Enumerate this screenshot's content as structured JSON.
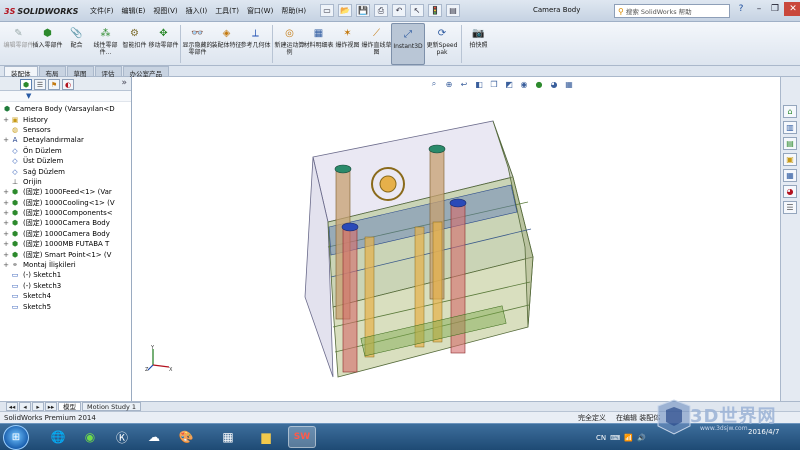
{
  "app": {
    "logo_prefix": "3S",
    "logo_text": "SOLIDWORKS",
    "document_title": "Camera Body"
  },
  "menu": [
    "文件(F)",
    "编辑(E)",
    "视图(V)",
    "插入(I)",
    "工具(T)",
    "窗口(W)",
    "帮助(H)"
  ],
  "help_search": {
    "placeholder": "搜索 SolidWorks 帮助"
  },
  "ribbon": {
    "buttons": [
      {
        "label": "编辑零部件",
        "icon": "edit-component-icon",
        "disabled": true
      },
      {
        "label": "插入零部件",
        "icon": "insert-component-icon"
      },
      {
        "label": "配合",
        "icon": "mate-icon"
      },
      {
        "label": "线性零部件...",
        "icon": "linear-pattern-icon"
      },
      {
        "label": "智能扣件",
        "icon": "smart-fastener-icon"
      },
      {
        "label": "移动零部件",
        "icon": "move-component-icon"
      },
      {
        "label": "显示隐藏的零部件",
        "icon": "show-hidden-icon"
      },
      {
        "label": "装配体特征",
        "icon": "assembly-feature-icon"
      },
      {
        "label": "参考几何体",
        "icon": "reference-geometry-icon"
      },
      {
        "label": "新建运动算例",
        "icon": "motion-study-icon"
      },
      {
        "label": "材料明细表",
        "icon": "bom-icon"
      },
      {
        "label": "爆炸视图",
        "icon": "exploded-view-icon"
      },
      {
        "label": "爆炸直线草图",
        "icon": "explode-line-icon"
      },
      {
        "label": "Instant3D",
        "icon": "instant3d-icon",
        "active": true
      },
      {
        "label": "更新Speedpak",
        "icon": "speedpak-icon"
      },
      {
        "label": "拍快照",
        "icon": "snapshot-icon"
      }
    ]
  },
  "command_tabs": [
    "装配体",
    "布局",
    "草图",
    "评估",
    "办公室产品"
  ],
  "tree": {
    "root": "Camera Body  (Varsayılan<D",
    "items": [
      {
        "label": "History",
        "icon": "history-folder-icon",
        "expand": "+"
      },
      {
        "label": "Sensors",
        "icon": "sensors-icon",
        "expand": ""
      },
      {
        "label": "Detaylandırmalar",
        "icon": "annotations-icon",
        "expand": "+"
      },
      {
        "label": "Ön Düzlem",
        "icon": "plane-icon",
        "expand": ""
      },
      {
        "label": "Üst Düzlem",
        "icon": "plane-icon",
        "expand": ""
      },
      {
        "label": "Sağ Düzlem",
        "icon": "plane-icon",
        "expand": ""
      },
      {
        "label": "Orijin",
        "icon": "origin-icon",
        "expand": ""
      },
      {
        "label": "(固定) 1000Feed<1> (Var",
        "icon": "part-icon",
        "expand": "+"
      },
      {
        "label": "(固定) 1000Cooling<1> (V",
        "icon": "part-icon",
        "expand": "+"
      },
      {
        "label": "(固定) 1000Components<",
        "icon": "part-icon",
        "expand": "+"
      },
      {
        "label": "(固定) 1000Camera Body",
        "icon": "part-icon",
        "expand": "+"
      },
      {
        "label": "(固定) 1000Camera Body",
        "icon": "part-icon",
        "expand": "+"
      },
      {
        "label": "(固定) 1000MB FUTABA T",
        "icon": "part-icon",
        "expand": "+"
      },
      {
        "label": "(固定) Smart Point<1> (V",
        "icon": "part-icon",
        "expand": "+"
      },
      {
        "label": "Montaj İlişkileri",
        "icon": "mates-icon",
        "expand": "+"
      },
      {
        "label": "(-) Sketch1",
        "icon": "sketch-icon",
        "expand": ""
      },
      {
        "label": "(-) Sketch3",
        "icon": "sketch-icon",
        "expand": ""
      },
      {
        "label": "Sketch4",
        "icon": "sketch-icon",
        "expand": ""
      },
      {
        "label": "Sketch5",
        "icon": "sketch-icon",
        "expand": ""
      }
    ]
  },
  "bottom_tabs": [
    "模型",
    "Motion Study 1"
  ],
  "status": {
    "product": "SolidWorks Premium 2014",
    "definition": "完全定义",
    "editing": "在编辑 装配体"
  },
  "taskbar": {
    "apps": [
      "explorer-icon",
      "360-browser-icon",
      "k-app-icon",
      "baidu-cloud-icon",
      "paint-icon",
      "calculator-icon",
      "folder-icon",
      "solidworks-icon"
    ],
    "tray_lang": "CN",
    "clock_time": "",
    "clock_date": "2016/4/7"
  },
  "watermark": {
    "text": "3D世界网",
    "sub": "www.3dsjw.com"
  }
}
